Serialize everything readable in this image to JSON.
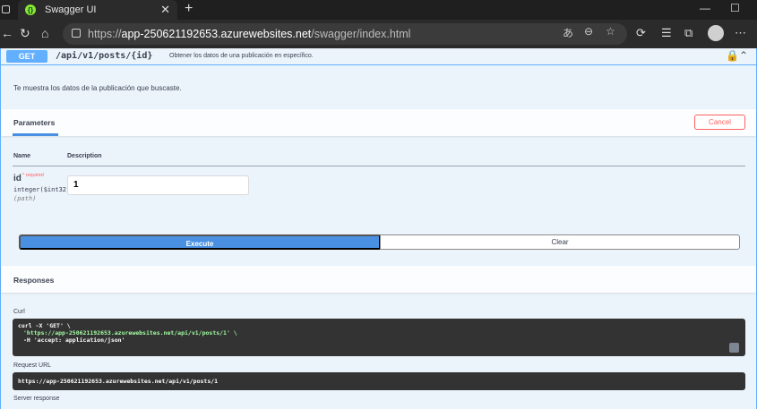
{
  "browser": {
    "tab_title": "Swagger UI",
    "url_host": "app-250621192653.azurewebsites.net",
    "url_prefix": "https://",
    "url_path": "/swagger/index.html"
  },
  "operation": {
    "method": "GET",
    "path": "/api/v1/posts/{id}",
    "summary": "Obtener los datos de una publicación en específico.",
    "description": "Te muestra los datos de la publicación que buscaste."
  },
  "parameters": {
    "title": "Parameters",
    "cancel_label": "Cancel",
    "col_name": "Name",
    "col_description": "Description",
    "items": [
      {
        "name": "id",
        "required_mark": "*",
        "required_label": "required",
        "type": "integer($int32)",
        "location": "(path)",
        "value": "1"
      }
    ]
  },
  "actions": {
    "execute_label": "Execute",
    "clear_label": "Clear"
  },
  "responses": {
    "title": "Responses",
    "curl_label": "Curl",
    "curl_line1": "curl -X 'GET' \\",
    "curl_line2": "'https://app-250621192653.azurewebsites.net/api/v1/posts/1' \\",
    "curl_line3": "-H 'accept: application/json'",
    "request_url_label": "Request URL",
    "request_url": "https://app-250621192653.azurewebsites.net/api/v1/posts/1",
    "server_response_label": "Server response"
  },
  "colors": {
    "get_blue": "#61affe",
    "execute_blue": "#4990e2",
    "cancel_red": "#ff6060"
  }
}
